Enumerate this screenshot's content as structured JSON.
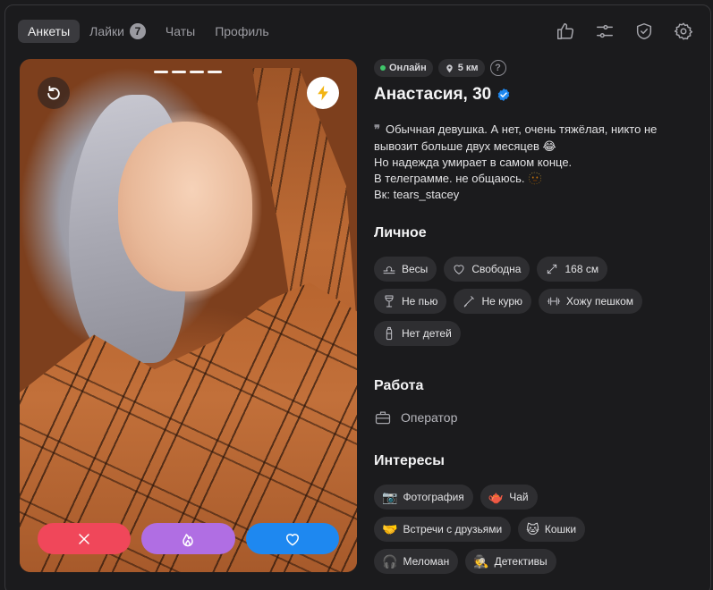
{
  "nav": {
    "tabs": [
      {
        "label": "Анкеты"
      },
      {
        "label": "Лайки",
        "badge": "7"
      },
      {
        "label": "Чаты"
      },
      {
        "label": "Профиль"
      }
    ],
    "icons": [
      "thumbs-up-icon",
      "sliders-icon",
      "shield-check-icon",
      "gear-icon"
    ]
  },
  "photo": {
    "page_count": 4,
    "current_page": 1
  },
  "profile": {
    "online": "Онлайн",
    "distance": "5 км",
    "help": "?",
    "name": "Анастасия, 30",
    "bio_lines": [
      "Обычная девушка. А нет, очень тяжёлая, никто не",
      "вывозит больше двух месяцев 😂",
      "Но надежда умирает в самом конце.",
      "В телеграмме. не общаюсь. 🫥",
      "Вк: tears_stacey"
    ]
  },
  "personal": {
    "title": "Личное",
    "chips": [
      {
        "icon": "libra-icon",
        "label": "Весы"
      },
      {
        "icon": "heart-outline-icon",
        "label": "Свободна"
      },
      {
        "icon": "height-arrows-icon",
        "label": "168 см"
      },
      {
        "icon": "wine-glass-icon",
        "label": "Не пью"
      },
      {
        "icon": "no-smoking-icon",
        "label": "Не курю"
      },
      {
        "icon": "dumbbell-icon",
        "label": "Хожу пешком"
      },
      {
        "icon": "baby-bottle-icon",
        "label": "Нет детей"
      }
    ]
  },
  "work": {
    "title": "Работа",
    "icon": "briefcase-icon",
    "label": "Оператор"
  },
  "interests": {
    "title": "Интересы",
    "chips": [
      {
        "emoji": "📷",
        "label": "Фотография"
      },
      {
        "emoji": "🫖",
        "label": "Чай"
      },
      {
        "emoji": "🤝",
        "label": "Встречи с друзьями"
      },
      {
        "emoji": "🐱",
        "label": "Кошки"
      },
      {
        "emoji": "🎧",
        "label": "Меломан"
      },
      {
        "emoji": "🕵️",
        "label": "Детективы"
      }
    ]
  },
  "colors": {
    "background": "#1b1b1d",
    "chip": "#2e2e31",
    "dislike": "#f0475a",
    "superlike": "#b06ee3",
    "like": "#1e88f0",
    "verified": "#1e88f0",
    "online": "#3fc66a"
  }
}
